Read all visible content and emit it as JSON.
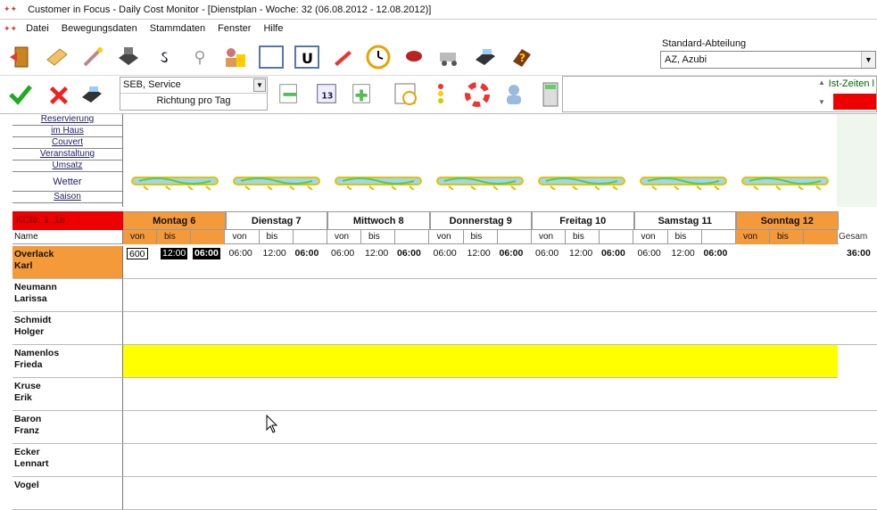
{
  "window": {
    "title": "Customer in Focus - Daily Cost Monitor - [Dienstplan - Woche: 32 (06.08.2012 - 12.08.2012)]"
  },
  "menu": [
    "Datei",
    "Bewegungsdaten",
    "Stammdaten",
    "Fenster",
    "Hilfe"
  ],
  "department": {
    "label": "Standard-Abteilung",
    "value": "AZ, Azubi"
  },
  "service": {
    "value": "SEB, Service",
    "sub": "Richtung  pro Tag"
  },
  "rightbox": {
    "label": "Ist-Zeiten l"
  },
  "leftlinks": [
    "Reservierung",
    "im Haus",
    "Couvert",
    "Veranstaltung",
    "Umsatz",
    "Wetter",
    "Saison"
  ],
  "grid": {
    "header_left": "KCfe..1..1e",
    "name_label": "Name",
    "days": [
      {
        "label": "Montag 6",
        "highlight": true
      },
      {
        "label": "Dienstag 7",
        "highlight": false
      },
      {
        "label": "Mittwoch 8",
        "highlight": false
      },
      {
        "label": "Donnerstag 9",
        "highlight": false
      },
      {
        "label": "Freitag 10",
        "highlight": false
      },
      {
        "label": "Samstag 11",
        "highlight": false
      },
      {
        "label": "Sonntag 12",
        "highlight": true
      }
    ],
    "von": "von",
    "bis": "bis",
    "total_label": "Gesam",
    "employees": [
      {
        "last": "Overlack",
        "first": "Karl",
        "highlight": "orange"
      },
      {
        "last": "Neumann",
        "first": "Larissa"
      },
      {
        "last": "Schmidt",
        "first": "Holger"
      },
      {
        "last": "Namenlos",
        "first": "Frieda",
        "highlight": "yellow"
      },
      {
        "last": "Kruse",
        "first": "Erik"
      },
      {
        "last": "Baron",
        "first": "Franz"
      },
      {
        "last": "Ecker",
        "first": "Lennart"
      },
      {
        "last": "Vogel",
        "first": ""
      }
    ],
    "first_row_times": {
      "von": "06:00",
      "bis": "12:00",
      "sum": "06:00",
      "first_von": "600",
      "total": "36:00"
    }
  },
  "colors": {
    "accent_orange": "#f59a3a",
    "red": "#ee0000",
    "yellow": "#ffff00"
  }
}
